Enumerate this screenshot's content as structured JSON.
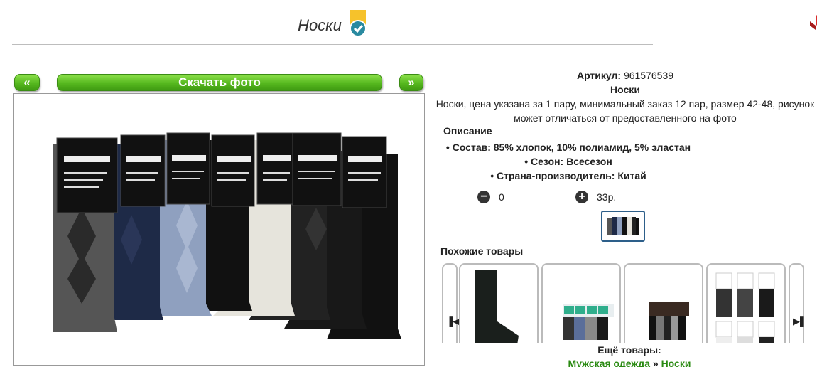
{
  "header": {
    "title": "Носки"
  },
  "gallery": {
    "prev_label": "«",
    "download_label": "Скачать фото",
    "next_label": "»"
  },
  "product": {
    "article_label": "Артикул:",
    "article_value": "961576539",
    "name": "Носки",
    "summary": "Носки, цена указана за 1 пару, минимальный заказ 12 пар, размер 42-48, рисунок может отличаться от предоставленного на фото",
    "description_heading": "Описание",
    "description": [
      "Состав: 85% хлопок, 10% полиамид, 5% эластан",
      "Сезон: Всесезон",
      "Страна-производитель: Китай"
    ]
  },
  "order": {
    "minus_icon": "minus-circle-icon",
    "quantity": "0",
    "plus_icon": "plus-circle-icon",
    "price": "33р."
  },
  "similar": {
    "heading": "Похожие товары",
    "prev_icon": "chevron-left-icon",
    "next_icon": "chevron-right-icon"
  },
  "more": {
    "label": "Ещё товары:",
    "crumb_1": "Мужская одежда",
    "separator": " » ",
    "crumb_2": "Носки"
  },
  "colors": {
    "accent_green": "#56b81f",
    "link_green": "#2a8a12",
    "badge_yellow": "#f6c22b",
    "badge_teal": "#2a8aa0"
  }
}
